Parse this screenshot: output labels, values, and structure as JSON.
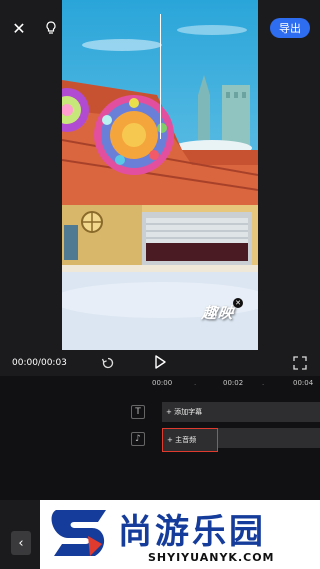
{
  "toolbar": {
    "export_label": "导出"
  },
  "icons": {
    "close": "close-icon",
    "bulb": "lightbulb-icon",
    "undo": "undo-icon",
    "play": "play-icon",
    "fullscreen": "fullscreen-icon",
    "back": "chevron-left-icon"
  },
  "preview": {
    "watermark": "趣映"
  },
  "player": {
    "time": "00:00/00:03"
  },
  "timeline": {
    "ticks": [
      "00:00",
      "00:02",
      "00:04"
    ],
    "tracks": {
      "subtitle_icon": "T",
      "subtitle_label": "+ 添加字幕",
      "audio_icon": "♪",
      "audio_label": "+ 主音频"
    }
  },
  "banner": {
    "title": "尚游乐园",
    "subtitle": "SHYIYUANYK.COM",
    "logo_letter": "S"
  },
  "colors": {
    "accent": "#2f6df0",
    "highlight": "#e03b2f",
    "banner_blue": "#153c9a"
  }
}
